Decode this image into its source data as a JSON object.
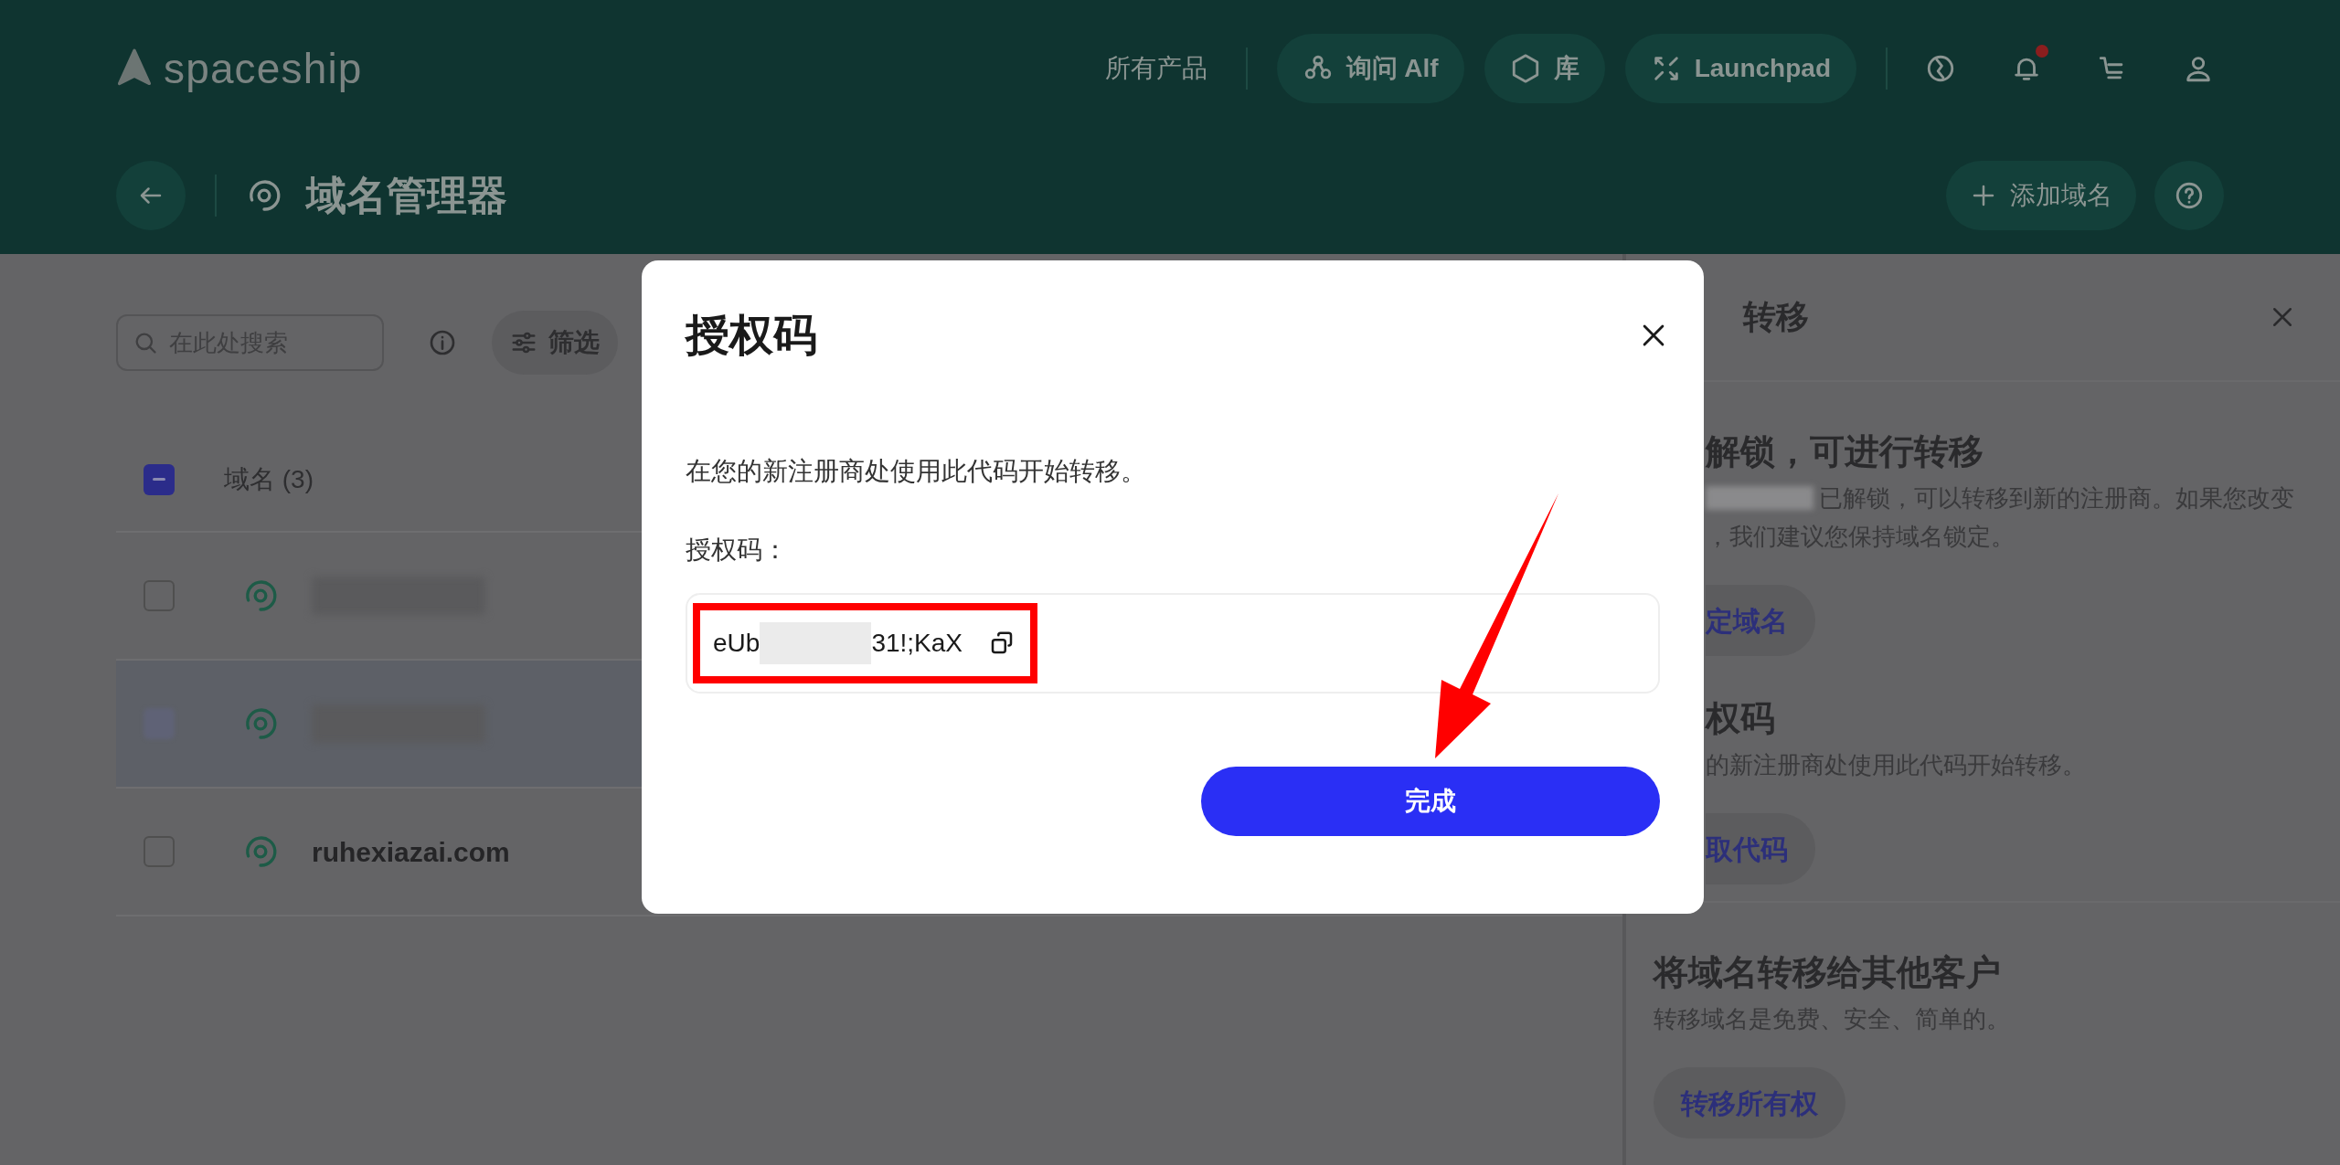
{
  "header": {
    "logo_text": "spaceship",
    "products_link": "所有产品",
    "nav_pills": [
      "询问 Alf",
      "库",
      "Launchpad"
    ],
    "has_notification": true
  },
  "page": {
    "title": "域名管理器",
    "add_button": "添加域名"
  },
  "toolbar": {
    "search": {
      "placeholder": "在此处搜索"
    },
    "filter_button": "筛选"
  },
  "table": {
    "header": {
      "label": "域名 (3)",
      "indeterminate": true
    },
    "rows": [
      {
        "redacted": true,
        "selected": false
      },
      {
        "redacted": true,
        "selected": true
      },
      {
        "domain": "ruhexiazai.com",
        "redacted": false,
        "selected": false
      }
    ]
  },
  "side_panel": {
    "title": "转移",
    "sections": [
      {
        "title": "解锁，可进行转移",
        "lines": [
          "已解锁，可以转移到新的注册商。如果您改变",
          "，我们建议您保持域名锁定。"
        ],
        "redacted_lead": true,
        "button": "定域名",
        "cut": true
      },
      {
        "title": "权码",
        "lines": [
          "的新注册商处使用此代码开始转移。"
        ],
        "button": "取代码",
        "cut": true
      },
      {
        "title": "将域名转移给其他客户",
        "lines": [
          "转移域名是免费、安全、简单的。"
        ],
        "button": "转移所有权",
        "cut": false
      }
    ]
  },
  "modal": {
    "title": "授权码",
    "description": "在您的新注册商处使用此代码开始转移。",
    "code_label": "授权码：",
    "code_start": "eUb",
    "code_end": "31!;KaX",
    "done_button": "完成"
  }
}
